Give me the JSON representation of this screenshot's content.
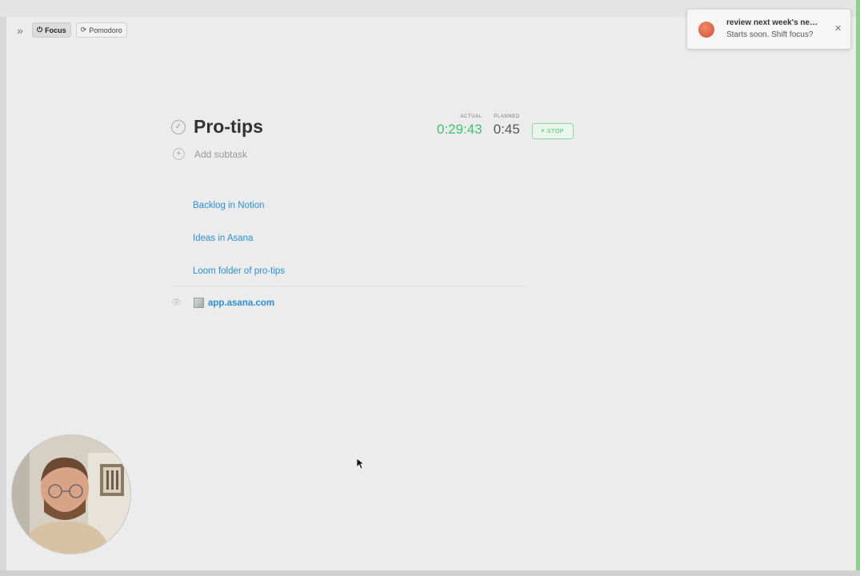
{
  "toolbar": {
    "collapse_icon": "chevrons-right-icon",
    "modes": [
      {
        "label": "Focus",
        "icon": "power-icon",
        "active": true
      },
      {
        "label": "Pomodoro",
        "icon": "timer-icon",
        "active": false
      }
    ]
  },
  "task": {
    "title": "Pro-tips",
    "add_subtask_placeholder": "Add subtask"
  },
  "timer": {
    "actual_caption": "ACTUAL",
    "actual_value": "0:29:43",
    "planned_caption": "PLANNED",
    "planned_value": "0:45",
    "stop_label": "STOP"
  },
  "links": [
    {
      "label": "Backlog in Notion"
    },
    {
      "label": "Ideas in Asana"
    },
    {
      "label": "Loom folder of pro-tips"
    }
  ],
  "resource": {
    "label": "app.asana.com"
  },
  "notification": {
    "title": "review next week's ne…",
    "subtitle": "Starts soon. Shift focus?"
  },
  "colors": {
    "actual_green": "#3fc46e",
    "link_blue": "#2b8fd6",
    "toast_avatar": "#e0603f"
  }
}
